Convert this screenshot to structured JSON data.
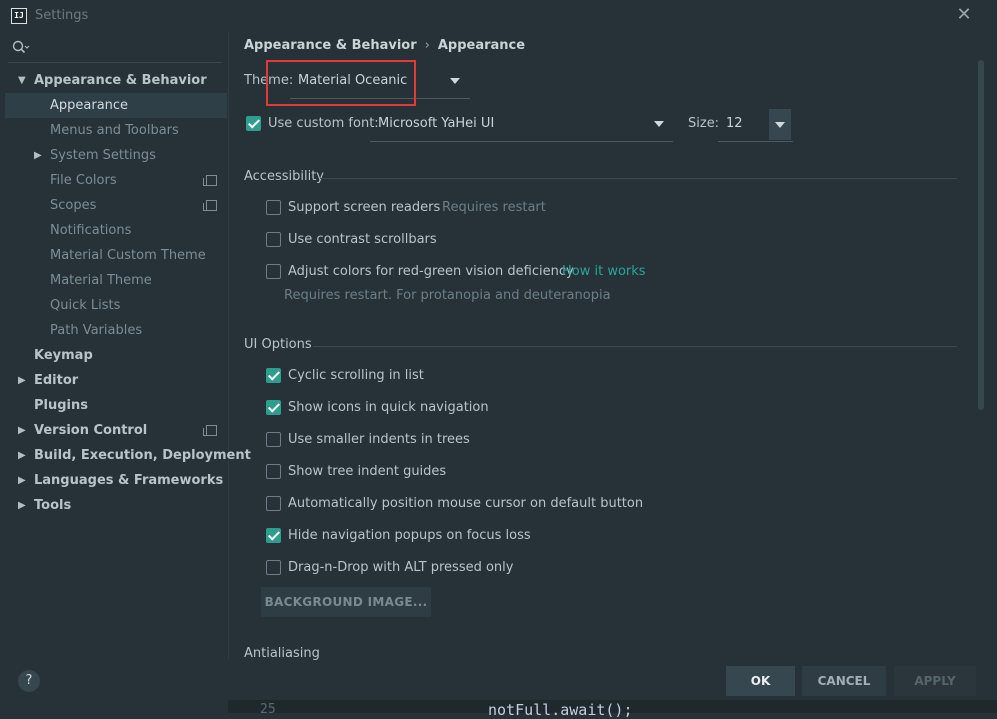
{
  "window": {
    "title": "Settings",
    "app_icon_text": "IJ"
  },
  "sidebar": {
    "items": [
      {
        "label": "Appearance & Behavior",
        "level": 0,
        "expanded": true,
        "has_arrow": true,
        "copy_icon": false
      },
      {
        "label": "Appearance",
        "level": 1,
        "selected": true,
        "has_arrow": false,
        "copy_icon": false
      },
      {
        "label": "Menus and Toolbars",
        "level": 1,
        "has_arrow": false,
        "copy_icon": false
      },
      {
        "label": "System Settings",
        "level": 1,
        "has_arrow": true,
        "copy_icon": false
      },
      {
        "label": "File Colors",
        "level": 1,
        "has_arrow": false,
        "copy_icon": true
      },
      {
        "label": "Scopes",
        "level": 1,
        "has_arrow": false,
        "copy_icon": true
      },
      {
        "label": "Notifications",
        "level": 1,
        "has_arrow": false,
        "copy_icon": false
      },
      {
        "label": "Material Custom Theme",
        "level": 1,
        "has_arrow": false,
        "copy_icon": false
      },
      {
        "label": "Material Theme",
        "level": 1,
        "has_arrow": false,
        "copy_icon": false
      },
      {
        "label": "Quick Lists",
        "level": 1,
        "has_arrow": false,
        "copy_icon": false
      },
      {
        "label": "Path Variables",
        "level": 1,
        "has_arrow": false,
        "copy_icon": false
      },
      {
        "label": "Keymap",
        "level": 0,
        "has_arrow": false,
        "copy_icon": false
      },
      {
        "label": "Editor",
        "level": 0,
        "has_arrow": true,
        "copy_icon": false
      },
      {
        "label": "Plugins",
        "level": 0,
        "has_arrow": false,
        "copy_icon": false
      },
      {
        "label": "Version Control",
        "level": 0,
        "has_arrow": true,
        "copy_icon": true
      },
      {
        "label": "Build, Execution, Deployment",
        "level": 0,
        "has_arrow": true,
        "copy_icon": false
      },
      {
        "label": "Languages & Frameworks",
        "level": 0,
        "has_arrow": true,
        "copy_icon": false
      },
      {
        "label": "Tools",
        "level": 0,
        "has_arrow": true,
        "copy_icon": false
      }
    ]
  },
  "breadcrumb": {
    "parent": "Appearance & Behavior",
    "separator": "›",
    "current": "Appearance"
  },
  "theme": {
    "label": "Theme:",
    "value": "Material Oceanic"
  },
  "font": {
    "checkbox_label": "Use custom font:",
    "checked": true,
    "value": "Microsoft YaHei UI",
    "size_label": "Size:",
    "size_value": "12"
  },
  "accessibility": {
    "title": "Accessibility",
    "screen_readers": {
      "label": "Support screen readers",
      "checked": false,
      "hint": "Requires restart"
    },
    "contrast_scrollbars": {
      "label": "Use contrast scrollbars",
      "checked": false
    },
    "color_deficiency": {
      "label": "Adjust colors for red-green vision deficiency",
      "checked": false,
      "link": "How it works",
      "hint": "Requires restart. For protanopia and deuteranopia"
    }
  },
  "ui_options": {
    "title": "UI Options",
    "options": [
      {
        "label": "Cyclic scrolling in list",
        "checked": true
      },
      {
        "label": "Show icons in quick navigation",
        "checked": true
      },
      {
        "label": "Use smaller indents in trees",
        "checked": false
      },
      {
        "label": "Show tree indent guides",
        "checked": false
      },
      {
        "label": "Automatically position mouse cursor on default button",
        "checked": false
      },
      {
        "label": "Hide navigation popups on focus loss",
        "checked": true
      },
      {
        "label": "Drag-n-Drop with ALT pressed only",
        "checked": false
      }
    ],
    "background_button": "BACKGROUND IMAGE..."
  },
  "antialiasing": {
    "title": "Antialiasing"
  },
  "buttons": {
    "help": "?",
    "ok": "OK",
    "cancel": "CANCEL",
    "apply": "APPLY"
  },
  "editor_peek": {
    "line_number": "25",
    "code": "notFull.await();"
  },
  "colors": {
    "accent": "#2f9e8f",
    "link": "#26a69a",
    "highlight": "#e53935",
    "background": "#263238"
  }
}
